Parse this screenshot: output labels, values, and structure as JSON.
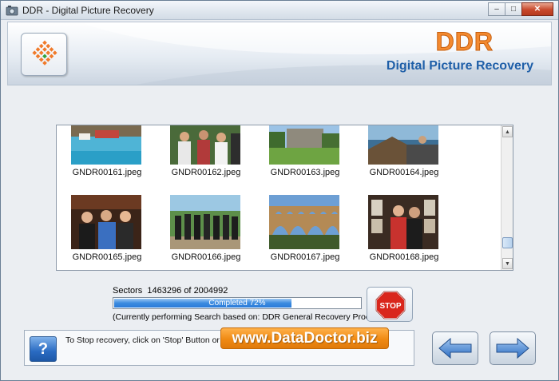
{
  "window": {
    "title": "DDR - Digital Picture Recovery",
    "minimize_glyph": "–",
    "maximize_glyph": "□",
    "close_glyph": "✕"
  },
  "banner": {
    "brand": "DDR",
    "subtitle": "Digital Picture Recovery",
    "brand_color": "#f48a2f",
    "subtitle_color": "#1f5fa8"
  },
  "thumbnails": [
    {
      "file": "GNDR00161.jpeg"
    },
    {
      "file": "GNDR00162.jpeg"
    },
    {
      "file": "GNDR00163.jpeg"
    },
    {
      "file": "GNDR00164.jpeg"
    },
    {
      "file": "GNDR00165.jpeg"
    },
    {
      "file": "GNDR00166.jpeg"
    },
    {
      "file": "GNDR00167.jpeg"
    },
    {
      "file": "GNDR00168.jpeg"
    }
  ],
  "progress": {
    "sectors_label": "Sectors",
    "sectors_current": "1463296",
    "sectors_of": "of",
    "sectors_total": "2004992",
    "completed_text": "Completed 72%",
    "percent": 72,
    "procedure_text": "(Currently performing Search based on:  DDR General Recovery Procedure)"
  },
  "stop_button": {
    "label": "STOP"
  },
  "help": {
    "icon": "question-icon",
    "glyph": "?",
    "text": "To Stop recovery, click on 'Stop' Button or plea"
  },
  "watermark": {
    "text": "www.DataDoctor.biz"
  },
  "nav": {
    "back_icon": "arrow-left-icon",
    "next_icon": "arrow-right-icon"
  }
}
